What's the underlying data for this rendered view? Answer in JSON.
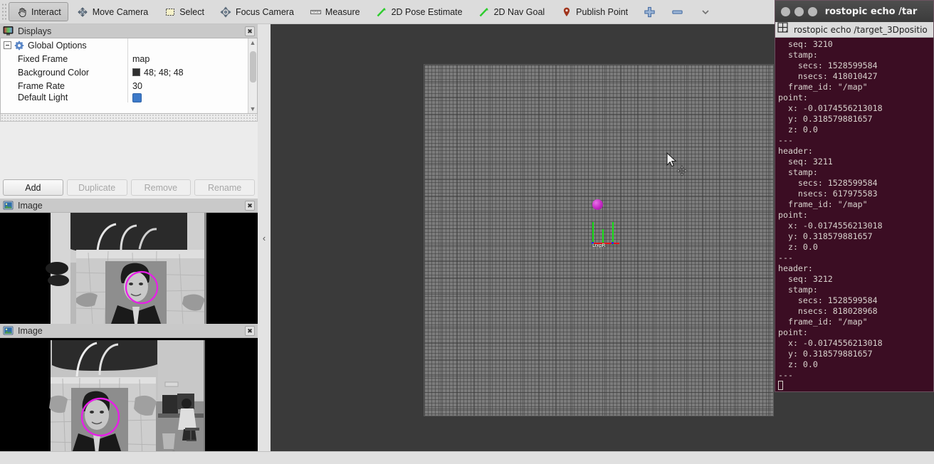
{
  "toolbar": {
    "items": [
      {
        "label": "Interact",
        "icon": "hand-icon",
        "active": true
      },
      {
        "label": "Move Camera",
        "icon": "move-camera-icon",
        "active": false
      },
      {
        "label": "Select",
        "icon": "select-rect-icon",
        "active": false
      },
      {
        "label": "Focus Camera",
        "icon": "focus-camera-icon",
        "active": false
      },
      {
        "label": "Measure",
        "icon": "ruler-icon",
        "active": false
      },
      {
        "label": "2D Pose Estimate",
        "icon": "pose-arrow-icon",
        "active": false
      },
      {
        "label": "2D Nav Goal",
        "icon": "nav-goal-arrow-icon",
        "active": false
      },
      {
        "label": "Publish Point",
        "icon": "map-pin-icon",
        "active": false
      },
      {
        "label": "",
        "icon": "plus-icon",
        "active": false
      },
      {
        "label": "",
        "icon": "minus-icon",
        "active": false
      },
      {
        "label": "",
        "icon": "chevron-down-icon",
        "active": false
      }
    ]
  },
  "displays_panel": {
    "title": "Displays",
    "close_label": "✖",
    "tree": [
      {
        "label": "Global Options",
        "value": "",
        "kind": "group"
      },
      {
        "label": "Fixed Frame",
        "value": "map",
        "kind": "text"
      },
      {
        "label": "Background Color",
        "value": "48; 48; 48",
        "kind": "color",
        "color": "#303030"
      },
      {
        "label": "Frame Rate",
        "value": "30",
        "kind": "text"
      },
      {
        "label": "Default Light",
        "value": "",
        "kind": "checkbox",
        "checked": true
      }
    ],
    "buttons": [
      {
        "label": "Add",
        "enabled": true
      },
      {
        "label": "Duplicate",
        "enabled": false
      },
      {
        "label": "Remove",
        "enabled": false
      },
      {
        "label": "Rename",
        "enabled": false
      }
    ]
  },
  "image_panel_1": {
    "title": "Image",
    "close_label": "✖"
  },
  "image_panel_2": {
    "title": "Image",
    "close_label": "✖"
  },
  "collapse_handle": {
    "glyph": "‹"
  },
  "view3d": {
    "background_color": "#3a3a3a",
    "grid_color": "#7c7c7c",
    "marker_color": "#c426c4",
    "tf_labels": [
      "L",
      "r",
      "x",
      "p",
      "R"
    ],
    "axis_colors": {
      "x": "#e81414",
      "y": "#14e014",
      "z": "#2a2ae0"
    }
  },
  "terminal": {
    "window_title": "rostopic echo /tar",
    "tab_label": "rostopic echo /target_3Dpositio",
    "background": "#3b0d23",
    "text": "  seq: 3210\n  stamp:\n    secs: 1528599584\n    nsecs: 418010427\n  frame_id: \"/map\"\npoint:\n  x: -0.0174556213018\n  y: 0.318579881657\n  z: 0.0\n---\nheader:\n  seq: 3211\n  stamp:\n    secs: 1528599584\n    nsecs: 617975583\n  frame_id: \"/map\"\npoint:\n  x: -0.0174556213018\n  y: 0.318579881657\n  z: 0.0\n---\nheader:\n  seq: 3212\n  stamp:\n    secs: 1528599584\n    nsecs: 818028968\n  frame_id: \"/map\"\npoint:\n  x: -0.0174556213018\n  y: 0.318579881657\n  z: 0.0\n---\n",
    "messages": [
      {
        "seq": "3210",
        "secs": "1528599584",
        "nsecs": "418010427",
        "frame_id": "\"/map\"",
        "x": "-0.0174556213018",
        "y": "0.318579881657",
        "z": "0.0"
      },
      {
        "seq": "3211",
        "secs": "1528599584",
        "nsecs": "617975583",
        "frame_id": "\"/map\"",
        "x": "-0.0174556213018",
        "y": "0.318579881657",
        "z": "0.0"
      },
      {
        "seq": "3212",
        "secs": "1528599584",
        "nsecs": "818028968",
        "frame_id": "\"/map\"",
        "x": "-0.0174556213018",
        "y": "0.318579881657",
        "z": "0.0"
      }
    ]
  }
}
